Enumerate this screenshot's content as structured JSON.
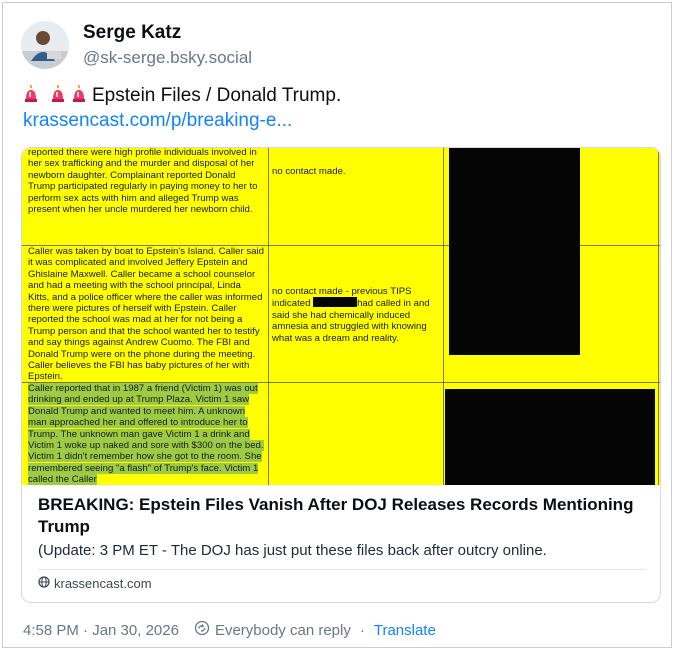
{
  "post": {
    "author_name": "Serge Katz",
    "author_handle": "@sk-serge.bsky.social",
    "text": "Epstein Files / Donald Trump.",
    "emoji_icons": [
      "siren-icon",
      "siren-icon",
      "siren-icon"
    ],
    "link_text": "krassencast.com/p/breaking-e..."
  },
  "embed": {
    "title": "BREAKING: Epstein Files Vanish After DOJ Releases Records Mentioning Trump",
    "description": "(Update: 3 PM ET - The DOJ has just put these files back after outcry online.",
    "domain": "krassencast.com",
    "document": {
      "row1_col1": "reported there were high profile individuals involved in her sex trafficking and the murder and disposal of her newborn daughter. Complainant reported Donald Trump participated regularly in paying money to her to perform sex acts with him and alleged Trump was present when her uncle murdered her newborn child.",
      "row1_col2": "no contact made.",
      "row2_col1": "Caller was taken by boat to Epstein's Island. Caller said it was complicated and involved Jeffery Epstein and Ghislaine Maxwell. Caller became a school counselor and had a meeting with the school principal, Linda Kitts, and a police officer where the caller was informed there were pictures of herself with Epstein. Caller reported the school was mad at her for not being a Trump person and that the school wanted her to testify and say things against Andrew Cuomo. The FBI and Donald Trump were on the phone during the meeting. Caller believes the FBI has baby pictures of her with Epstein.",
      "row2_col2_a": "no contact made - previous TIPS indicated",
      "row2_col2_b": "had called in and said she had chemically induced amnesia and struggled with knowing what was a dream and reality.",
      "row3_col1": "Caller reported that in 1987 a friend (Victim 1) was out drinking and ended up at Trump Plaza. Victim 1 saw Donald Trump and wanted to meet him. A unknown man approached her and offered to introduce her to Trump. The unknown man gave Victim 1 a drink and Victim 1 woke up naked and sore with $300 on the bed. Victim 1 didn't remember how she got to the room. She remembered seeing \"a flash\" of Trump's face. Victim 1 called the Caller"
    }
  },
  "footer": {
    "timestamp": "4:58 PM · Jan 30, 2026",
    "reply_setting": "Everybody can reply",
    "separator": "·",
    "translate": "Translate"
  },
  "colors": {
    "link": "#1083fe",
    "document_yellow": "#ffff00",
    "highlight_green": "#9dcc44",
    "redaction": "#050505"
  }
}
